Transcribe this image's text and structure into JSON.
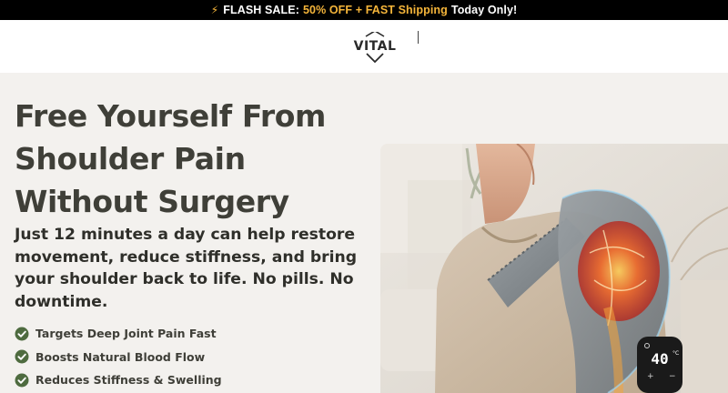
{
  "announcement": {
    "lead": "FLASH SALE:",
    "offer": "50% OFF + FAST Shipping",
    "suffix": "Today Only!",
    "icon": "lightning-bolt-icon"
  },
  "header": {
    "logo_text": "VITAL"
  },
  "hero": {
    "headline": "Free Yourself From Shoulder Pain Without Surgery",
    "subheadline": "Just 12 minutes a day can help restore movement, reduce stiffness, and bring your shoulder back to life. No pills. No downtime.",
    "benefits": [
      {
        "text": "Targets Deep Joint Pain Fast",
        "icon": "check-circle-icon"
      },
      {
        "text": "Boosts Natural Blood Flow",
        "icon": "check-circle-icon"
      },
      {
        "text": "Reduces Stiffness & Swelling",
        "icon": "check-circle-icon"
      }
    ],
    "device_display": "40",
    "device_unit": "°C"
  },
  "colors": {
    "accent": "#f5b53a",
    "check_green": "#4e6b3f",
    "heading": "#3f3f38",
    "background": "#f3f1ee"
  }
}
